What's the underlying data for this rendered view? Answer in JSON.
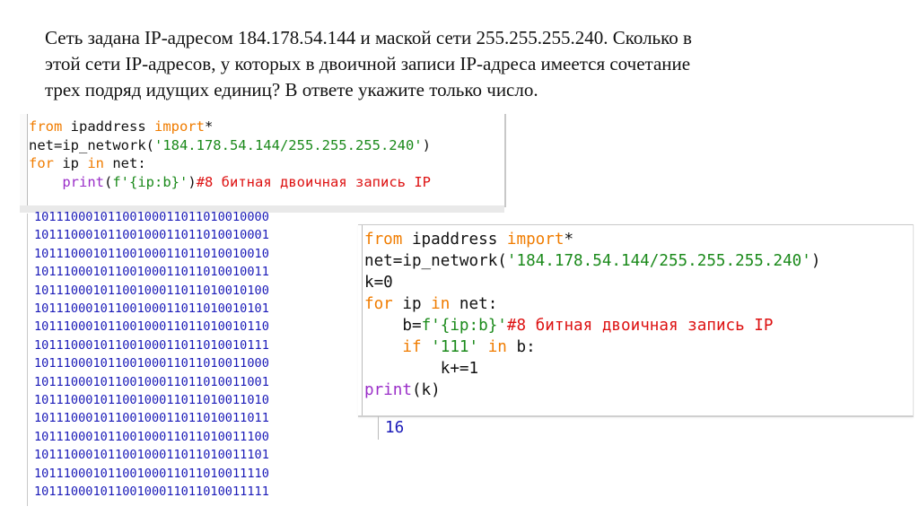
{
  "question": {
    "line1": "Сеть задана IP-адресом 184.178.54.144 и маской сети 255.255.255.240. Сколько в",
    "line2": "этой сети IP-адресов, у которых в двоичной записи IP-адреса имеется сочетание",
    "line3": "трех подряд идущих единиц? В ответе укажите только число."
  },
  "code1": {
    "line1": {
      "kw1": "from",
      "t1": " ipaddress ",
      "kw2": "import",
      "t2": "*"
    },
    "line2": {
      "t1": "net=ip_network(",
      "str": "'184.178.54.144/255.255.255.240'",
      "t2": ")"
    },
    "line3": {
      "kw1": "for",
      "t1": " ip ",
      "kw2": "in",
      "t2": " net:"
    },
    "line4": {
      "indent": "    ",
      "bi": "print",
      "t1": "(",
      "str": "f'{ip:b}'",
      "t2": ")",
      "cmt": "#8 битная двоичная запись IP"
    }
  },
  "output": [
    "10111000101100100011011010010000",
    "10111000101100100011011010010001",
    "10111000101100100011011010010010",
    "10111000101100100011011010010011",
    "10111000101100100011011010010100",
    "10111000101100100011011010010101",
    "10111000101100100011011010010110",
    "10111000101100100011011010010111",
    "10111000101100100011011010011000",
    "10111000101100100011011010011001",
    "10111000101100100011011010011010",
    "10111000101100100011011010011011",
    "10111000101100100011011010011100",
    "10111000101100100011011010011101",
    "10111000101100100011011010011110",
    "10111000101100100011011010011111"
  ],
  "code2": {
    "line1": {
      "kw1": "from",
      "t1": " ipaddress ",
      "kw2": "import",
      "t2": "*"
    },
    "line2": {
      "t1": "net=ip_network(",
      "str": "'184.178.54.144/255.255.255.240'",
      "t2": ")"
    },
    "line3": {
      "t1": "k=0"
    },
    "line4": {
      "kw1": "for",
      "t1": " ip ",
      "kw2": "in",
      "t2": " net:"
    },
    "line5": {
      "indent": "    ",
      "t1": "b=",
      "str": "f'{ip:b}'",
      "cmt": "#8 битная двоичная запись IP"
    },
    "line6": {
      "indent": "    ",
      "kw1": "if",
      "t1": " ",
      "str": "'111'",
      "t2": " ",
      "kw2": "in",
      "t3": " b:"
    },
    "line7": {
      "indent": "        ",
      "t1": "k+=1"
    },
    "line8": {
      "bi": "print",
      "t1": "(k)"
    }
  },
  "result": "16",
  "colors": {
    "keyword": "#f07c00",
    "builtin": "#9a2ec8",
    "string": "#1b8a1b",
    "comment": "#d11111",
    "output": "#1a1ab8"
  }
}
